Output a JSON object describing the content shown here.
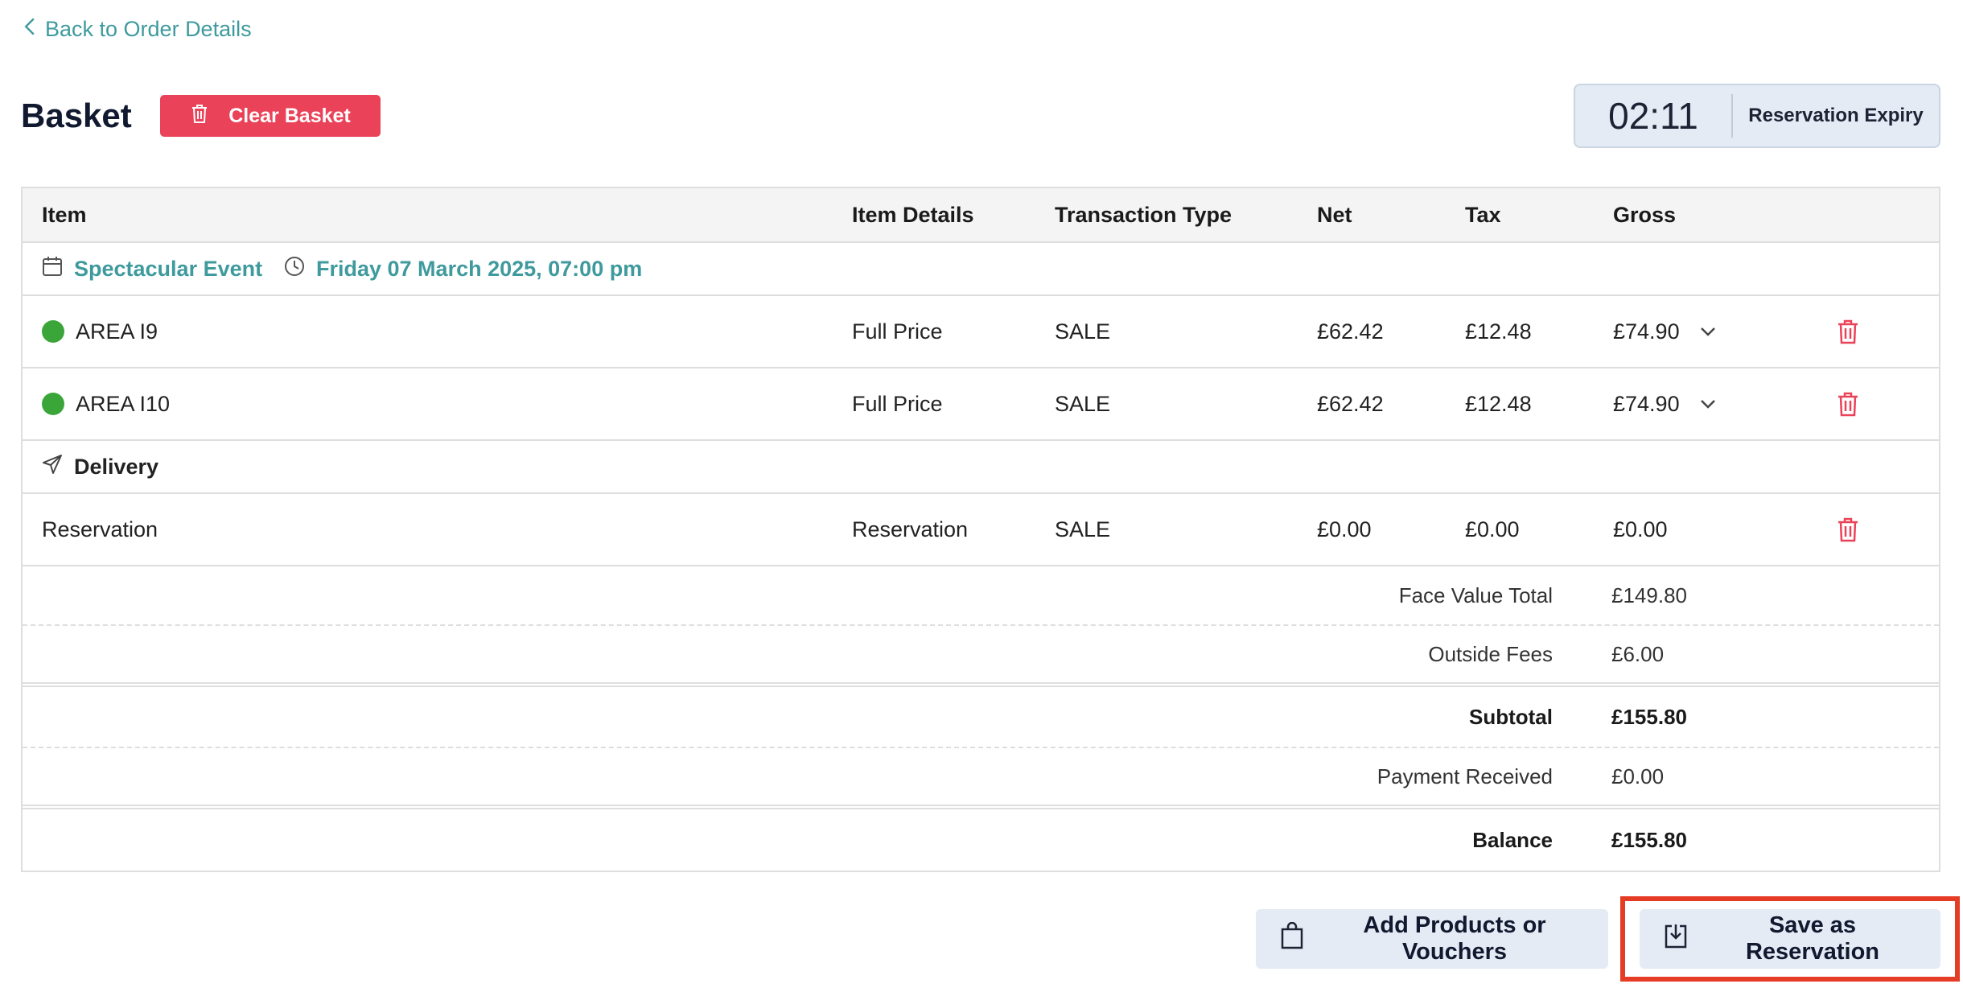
{
  "nav": {
    "back_label": "Back to Order Details"
  },
  "header": {
    "title": "Basket",
    "clear_label": "Clear Basket",
    "timer_value": "02:11",
    "timer_label": "Reservation Expiry"
  },
  "table": {
    "columns": [
      "Item",
      "Item Details",
      "Transaction Type",
      "Net",
      "Tax",
      "Gross"
    ],
    "event": {
      "name": "Spectacular Event",
      "date": "Friday 07 March 2025, 07:00 pm"
    },
    "items": [
      {
        "name": "AREA I9",
        "details": "Full Price",
        "type": "SALE",
        "net": "£62.42",
        "tax": "£12.48",
        "gross": "£74.90"
      },
      {
        "name": "AREA I10",
        "details": "Full Price",
        "type": "SALE",
        "net": "£62.42",
        "tax": "£12.48",
        "gross": "£74.90"
      }
    ],
    "delivery_label": "Delivery",
    "delivery_items": [
      {
        "name": "Reservation",
        "details": "Reservation",
        "type": "SALE",
        "net": "£0.00",
        "tax": "£0.00",
        "gross": "£0.00"
      }
    ]
  },
  "totals": {
    "face_value_label": "Face Value Total",
    "face_value": "£149.80",
    "outside_fees_label": "Outside Fees",
    "outside_fees": "£6.00",
    "subtotal_label": "Subtotal",
    "subtotal": "£155.80",
    "payment_label": "Payment Received",
    "payment": "£0.00",
    "balance_label": "Balance",
    "balance": "£155.80"
  },
  "footer": {
    "add_label": "Add Products or Vouchers",
    "save_label": "Save as Reservation"
  },
  "colors": {
    "accent_teal": "#3f9a9e",
    "danger": "#ea4258",
    "status_green": "#3aa63a",
    "highlight": "#e53c25"
  }
}
